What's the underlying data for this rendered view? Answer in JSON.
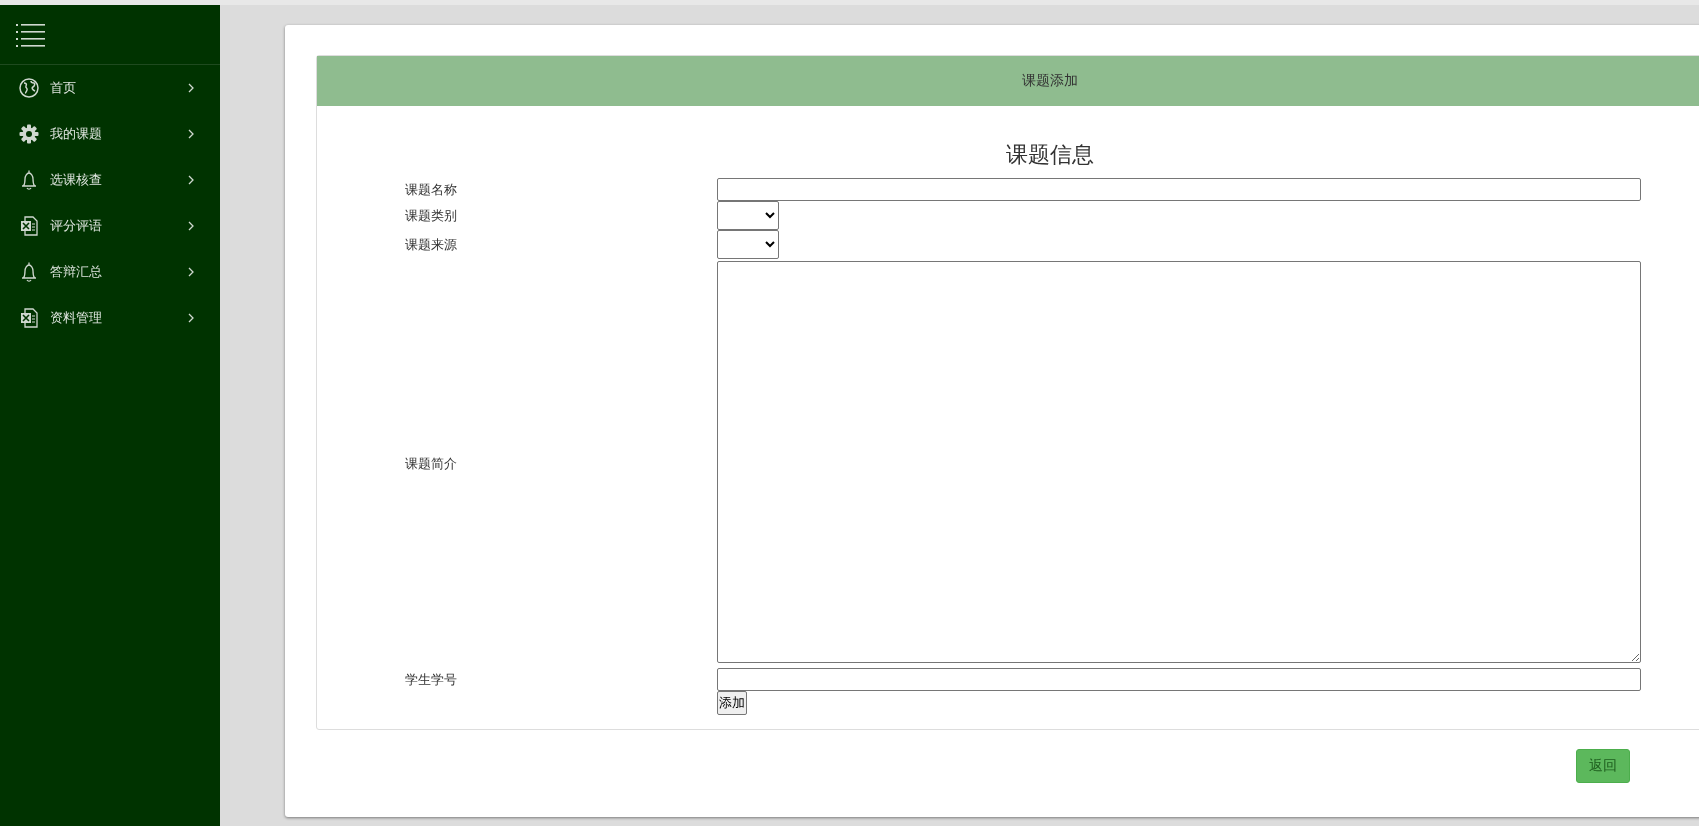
{
  "sidebar": {
    "items": [
      {
        "label": "首页",
        "kind": "globe"
      },
      {
        "label": "我的课题",
        "kind": "gear"
      },
      {
        "label": "选课核查",
        "kind": "bell"
      },
      {
        "label": "评分评语",
        "kind": "sheet"
      },
      {
        "label": "答辩汇总",
        "kind": "bell"
      },
      {
        "label": "资料管理",
        "kind": "sheet"
      }
    ]
  },
  "panel": {
    "title": "课题添加",
    "heading": "课题信息",
    "fields": [
      {
        "label": "课题名称",
        "kind": "text"
      },
      {
        "label": "课题类别",
        "kind": "select"
      },
      {
        "label": "课题来源",
        "kind": "select"
      },
      {
        "label": "课题简介",
        "kind": "textarea"
      },
      {
        "label": "学生学号",
        "kind": "text"
      }
    ],
    "submit": "添加"
  },
  "back_button": "返回"
}
